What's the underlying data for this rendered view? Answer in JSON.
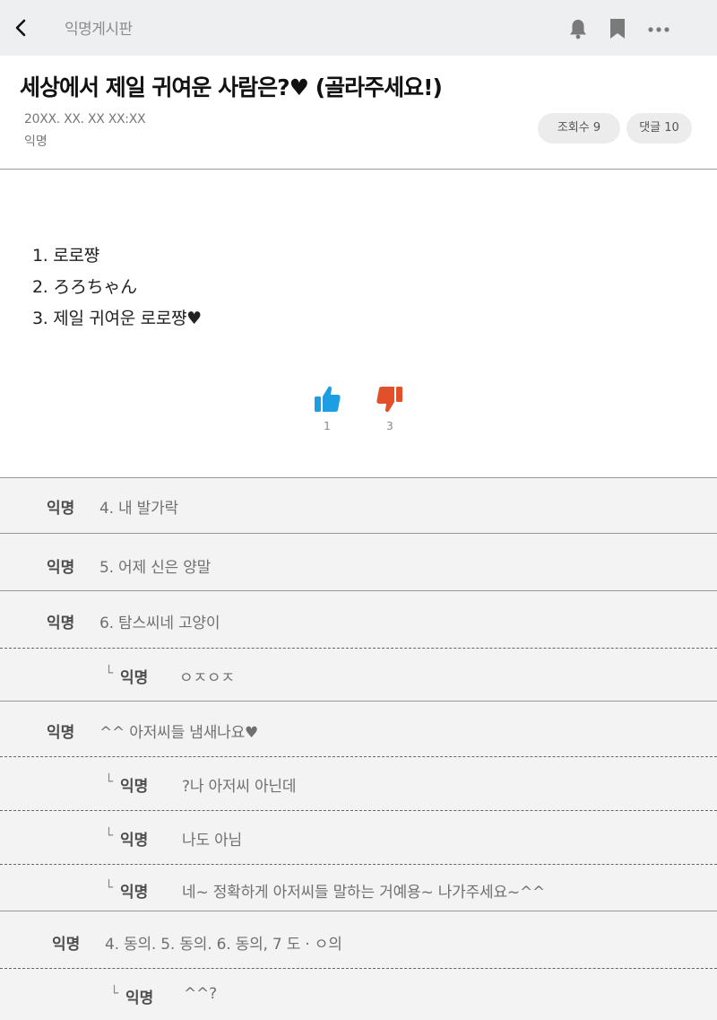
{
  "topbar": {
    "board_name": "익명게시판",
    "icons": [
      "chevron-left-icon",
      "bell-icon",
      "bookmark-icon",
      "more-icon"
    ]
  },
  "post": {
    "title": "세상에서 제일 귀여운 사람은?♥ (골라주세요!)",
    "date": "20XX. XX. XX   XX:XX",
    "author": "익명",
    "views_label": "조회수  9",
    "comments_label": "댓글 10",
    "items": [
      "1. 로로쨩",
      "2. ろろちゃん",
      "3. 제일 귀여운 로로쨩♥"
    ],
    "likes": "1",
    "dislikes": "3"
  },
  "colors": {
    "like": "#1d9ee2",
    "dislike": "#e2502a",
    "topbar_bg": "#eeeff1",
    "comment_bg": "#f3f3f3"
  },
  "comments": [
    {
      "reply": false,
      "author": "익명",
      "text": "4. 내 발가락"
    },
    {
      "reply": false,
      "author": "익명",
      "text": "5. 어제 신은 양말"
    },
    {
      "reply": false,
      "author": "익명",
      "text": "6. 탐스씨네 고양이"
    },
    {
      "reply": true,
      "mark": "└",
      "author": "익명",
      "text": "ㅇㅈㅇㅈ"
    },
    {
      "reply": false,
      "author": "익명",
      "text": "^^ 아저씨들 냄새나요♥"
    },
    {
      "reply": true,
      "mark": "└",
      "author": "익명",
      "text": "?나 아저씨 아닌데"
    },
    {
      "reply": true,
      "mark": "└",
      "author": "익명",
      "text": "나도 아님"
    },
    {
      "reply": true,
      "mark": "└",
      "author": "익명",
      "text": "네~ 정확하게 아저씨들 말하는 거예용~ 나가주세요~^^"
    },
    {
      "reply": false,
      "author": "익명",
      "text": "4. 동의. 5. 동의. 6. 동의, 7 도 · ㅇ의"
    },
    {
      "reply": true,
      "mark": "└",
      "author": "익명",
      "text": "^^?"
    }
  ]
}
